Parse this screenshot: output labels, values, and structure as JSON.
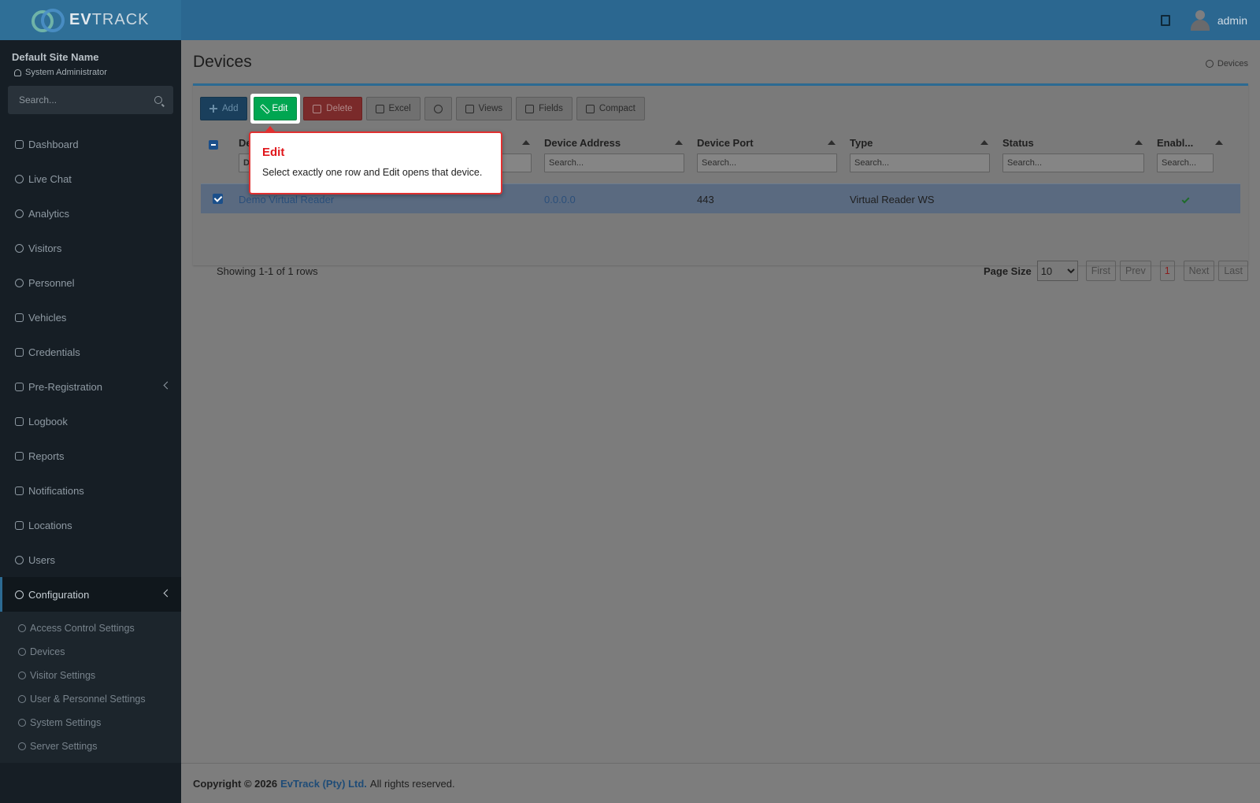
{
  "brand": {
    "logo_bold": "EV",
    "logo_rest": "TRACK"
  },
  "topbar": {
    "user": "admin"
  },
  "sidebar": {
    "site_name": "Default Site Name",
    "role": "System Administrator",
    "search_placeholder": "Search...",
    "items": [
      {
        "label": "Dashboard"
      },
      {
        "label": "Live Chat"
      },
      {
        "label": "Analytics"
      },
      {
        "label": "Visitors"
      },
      {
        "label": "Personnel"
      },
      {
        "label": "Vehicles"
      },
      {
        "label": "Credentials"
      },
      {
        "label": "Pre-Registration"
      },
      {
        "label": "Logbook"
      },
      {
        "label": "Reports"
      },
      {
        "label": "Notifications"
      },
      {
        "label": "Locations"
      },
      {
        "label": "Users"
      },
      {
        "label": "Configuration"
      }
    ],
    "config_sub": [
      {
        "label": "Access Control Settings"
      },
      {
        "label": "Devices"
      },
      {
        "label": "Visitor Settings"
      },
      {
        "label": "User & Personnel Settings"
      },
      {
        "label": "System Settings"
      },
      {
        "label": "Server Settings"
      }
    ]
  },
  "page": {
    "title": "Devices",
    "breadcrumb": "Devices"
  },
  "toolbar": {
    "add": "Add",
    "edit": "Edit",
    "delete": "Delete",
    "excel": "Excel",
    "views": "Views",
    "fields": "Fields",
    "compact": "Compact"
  },
  "grid": {
    "columns": [
      {
        "label": "De",
        "filter": "D"
      },
      {
        "label": "Device Address",
        "filter": "Search..."
      },
      {
        "label": "Device Port",
        "filter": "Search..."
      },
      {
        "label": "Type",
        "filter": "Search..."
      },
      {
        "label": "Status",
        "filter": "Search..."
      },
      {
        "label": "Enabl...",
        "filter": "Search..."
      }
    ],
    "rows": [
      {
        "name": "Demo Virtual Reader",
        "address": "0.0.0.0",
        "port": "443",
        "type": "Virtual Reader WS",
        "status": "",
        "enabled": true
      }
    ],
    "showing": "Showing 1-1 of 1 rows",
    "page_size_label": "Page Size",
    "page_size": "10",
    "pager": {
      "first": "First",
      "prev": "Prev",
      "current": "1",
      "next": "Next",
      "last": "Last"
    }
  },
  "tooltip": {
    "title": "Edit",
    "body": "Select exactly one row and Edit opens that device."
  },
  "footer": {
    "copyright": "Copyright © 2026",
    "company": "EvTrack (Pty) Ltd.",
    "rights": "All rights reserved."
  }
}
